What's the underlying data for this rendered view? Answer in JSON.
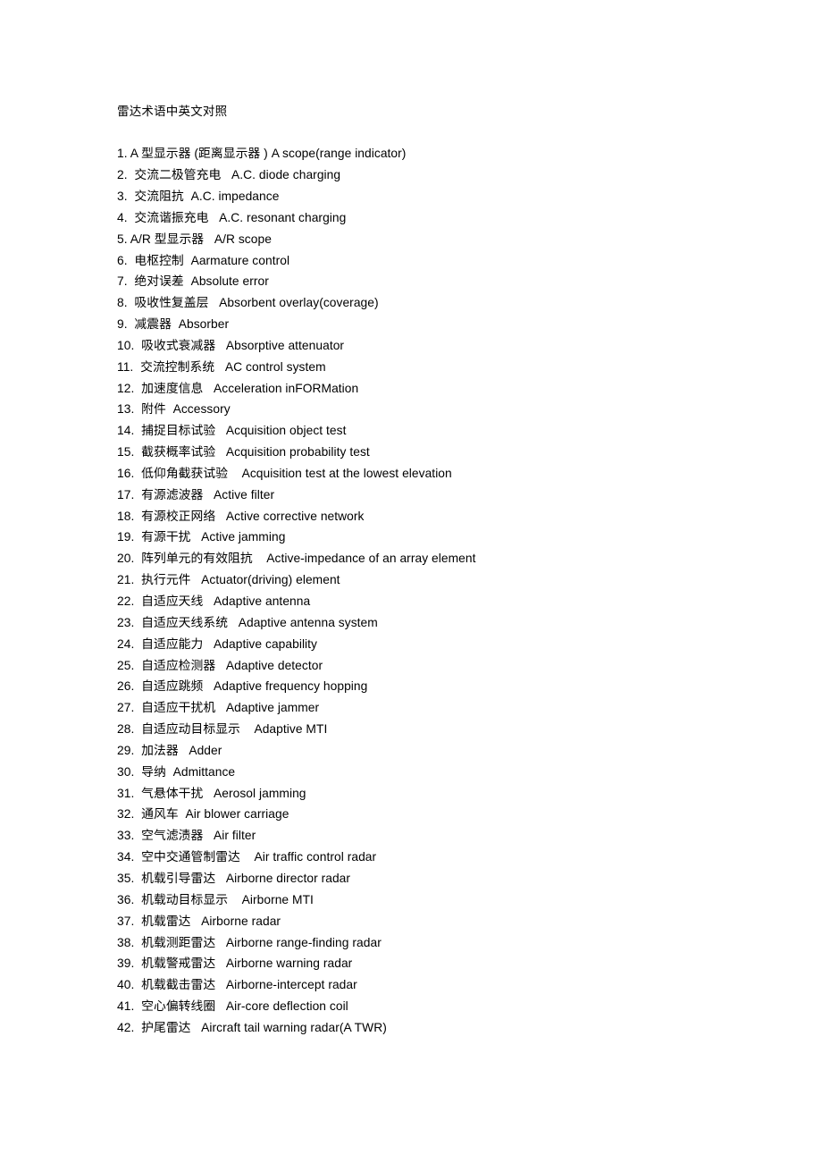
{
  "document": {
    "title": "雷达术语中英文对照",
    "terms": [
      {
        "index": "1.",
        "sep": " ",
        "zh": "A 型显示器 (距离显示器 )",
        "gap": " ",
        "en": "A scope(range indicator)"
      },
      {
        "index": "2.",
        "sep": "  ",
        "zh": "交流二极管充电",
        "gap": "   ",
        "en": "A.C. diode charging"
      },
      {
        "index": "3.",
        "sep": "  ",
        "zh": "交流阻抗",
        "gap": "  ",
        "en": "A.C. impedance"
      },
      {
        "index": "4.",
        "sep": "  ",
        "zh": "交流谐振充电",
        "gap": "   ",
        "en": "A.C. resonant charging"
      },
      {
        "index": "5.",
        "sep": " ",
        "zh": "A/R 型显示器",
        "gap": "   ",
        "en": "A/R scope"
      },
      {
        "index": "6.",
        "sep": "  ",
        "zh": "电枢控制",
        "gap": "  ",
        "en": "Aarmature control"
      },
      {
        "index": "7.",
        "sep": "  ",
        "zh": "绝对误差",
        "gap": "  ",
        "en": "Absolute error"
      },
      {
        "index": "8.",
        "sep": "  ",
        "zh": "吸收性复盖层",
        "gap": "   ",
        "en": "Absorbent overlay(coverage)"
      },
      {
        "index": "9.",
        "sep": "  ",
        "zh": "减震器",
        "gap": "  ",
        "en": "Absorber"
      },
      {
        "index": "10.",
        "sep": "  ",
        "zh": "吸收式衰减器",
        "gap": "   ",
        "en": "Absorptive attenuator"
      },
      {
        "index": "11.",
        "sep": "  ",
        "zh": "交流控制系统",
        "gap": "   ",
        "en": "AC control system"
      },
      {
        "index": "12.",
        "sep": "  ",
        "zh": "加速度信息",
        "gap": "   ",
        "en": "Acceleration inFORMation"
      },
      {
        "index": "13.",
        "sep": "  ",
        "zh": "附件",
        "gap": "  ",
        "en": "Accessory"
      },
      {
        "index": "14.",
        "sep": "  ",
        "zh": "捕捉目标试验",
        "gap": "   ",
        "en": "Acquisition object test"
      },
      {
        "index": "15.",
        "sep": "  ",
        "zh": "截获概率试验",
        "gap": "   ",
        "en": "Acquisition probability test"
      },
      {
        "index": "16.",
        "sep": "  ",
        "zh": "低仰角截获试验",
        "gap": "    ",
        "en": "Acquisition test at the lowest elevation"
      },
      {
        "index": "17.",
        "sep": "  ",
        "zh": "有源滤波器",
        "gap": "   ",
        "en": "Active filter"
      },
      {
        "index": "18.",
        "sep": "  ",
        "zh": "有源校正网络",
        "gap": "   ",
        "en": "Active corrective network"
      },
      {
        "index": "19.",
        "sep": "  ",
        "zh": "有源干扰",
        "gap": "   ",
        "en": "Active jamming"
      },
      {
        "index": "20.",
        "sep": "  ",
        "zh": "阵列单元的有效阻抗",
        "gap": "    ",
        "en": "Active-impedance of an array element"
      },
      {
        "index": "21.",
        "sep": "  ",
        "zh": "执行元件",
        "gap": "   ",
        "en": "Actuator(driving) element"
      },
      {
        "index": "22.",
        "sep": "  ",
        "zh": "自适应天线",
        "gap": "   ",
        "en": "Adaptive antenna"
      },
      {
        "index": "23.",
        "sep": "  ",
        "zh": "自适应天线系统",
        "gap": "   ",
        "en": "Adaptive antenna system"
      },
      {
        "index": "24.",
        "sep": "  ",
        "zh": "自适应能力",
        "gap": "   ",
        "en": "Adaptive capability"
      },
      {
        "index": "25.",
        "sep": "  ",
        "zh": "自适应检测器",
        "gap": "   ",
        "en": "Adaptive detector"
      },
      {
        "index": "26.",
        "sep": "  ",
        "zh": "自适应跳频",
        "gap": "   ",
        "en": "Adaptive frequency hopping"
      },
      {
        "index": "27.",
        "sep": "  ",
        "zh": "自适应干扰机",
        "gap": "   ",
        "en": "Adaptive jammer"
      },
      {
        "index": "28.",
        "sep": "  ",
        "zh": "自适应动目标显示",
        "gap": "    ",
        "en": "Adaptive MTI"
      },
      {
        "index": "29.",
        "sep": "  ",
        "zh": "加法器",
        "gap": "   ",
        "en": "Adder"
      },
      {
        "index": "30.",
        "sep": "  ",
        "zh": "导纳",
        "gap": "  ",
        "en": "Admittance"
      },
      {
        "index": "31.",
        "sep": "  ",
        "zh": "气悬体干扰",
        "gap": "   ",
        "en": "Aerosol jamming"
      },
      {
        "index": "32.",
        "sep": "  ",
        "zh": "通风车",
        "gap": "  ",
        "en": "Air blower carriage"
      },
      {
        "index": "33.",
        "sep": "  ",
        "zh": "空气滤渍器",
        "gap": "   ",
        "en": "Air filter"
      },
      {
        "index": "34.",
        "sep": "  ",
        "zh": "空中交通管制雷达",
        "gap": "    ",
        "en": "Air traffic control radar"
      },
      {
        "index": "35.",
        "sep": "  ",
        "zh": "机载引导雷达",
        "gap": "   ",
        "en": "Airborne director radar"
      },
      {
        "index": "36.",
        "sep": "  ",
        "zh": "机载动目标显示",
        "gap": "    ",
        "en": "Airborne MTI"
      },
      {
        "index": "37.",
        "sep": "  ",
        "zh": "机载雷达",
        "gap": "   ",
        "en": "Airborne radar"
      },
      {
        "index": "38.",
        "sep": "  ",
        "zh": "机载测距雷达",
        "gap": "   ",
        "en": "Airborne range-finding radar"
      },
      {
        "index": "39.",
        "sep": "  ",
        "zh": "机载警戒雷达",
        "gap": "   ",
        "en": "Airborne warning radar"
      },
      {
        "index": "40.",
        "sep": "  ",
        "zh": "机载截击雷达",
        "gap": "   ",
        "en": "Airborne-intercept radar"
      },
      {
        "index": "41.",
        "sep": "  ",
        "zh": "空心偏转线圈",
        "gap": "   ",
        "en": "Air-core deflection coil"
      },
      {
        "index": "42.",
        "sep": "  ",
        "zh": "护尾雷达",
        "gap": "   ",
        "en": "Aircraft tail warning radar(A TWR)"
      }
    ]
  }
}
